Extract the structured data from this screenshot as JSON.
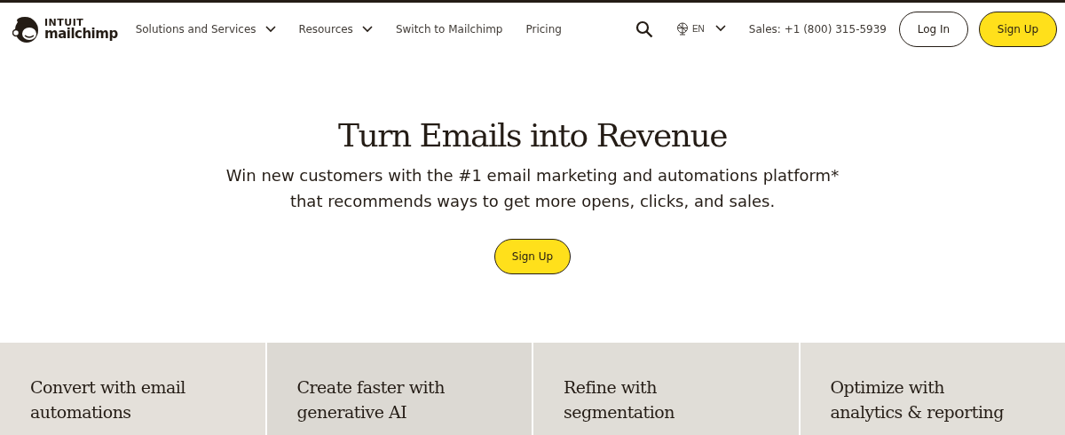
{
  "header": {
    "logo": {
      "brand_top": "INTUIT",
      "brand_bottom": "mailchimp"
    },
    "nav": [
      {
        "label": "Solutions and Services",
        "dropdown": true
      },
      {
        "label": "Resources",
        "dropdown": true
      },
      {
        "label": "Switch to Mailchimp",
        "dropdown": false
      },
      {
        "label": "Pricing",
        "dropdown": false
      }
    ],
    "language": "EN",
    "sales": "Sales: +1 (800) 315-5939",
    "login": "Log In",
    "signup": "Sign Up"
  },
  "hero": {
    "title": "Turn Emails into Revenue",
    "subtitle": "Win new customers with the #1 email marketing and automations platform* that recommends ways to get more opens, clicks, and sales.",
    "cta": "Sign Up"
  },
  "features": [
    {
      "title": "Convert with email automations"
    },
    {
      "title": "Create faster with generative AI"
    },
    {
      "title": "Refine with segmentation"
    },
    {
      "title": "Optimize with analytics & reporting"
    }
  ]
}
